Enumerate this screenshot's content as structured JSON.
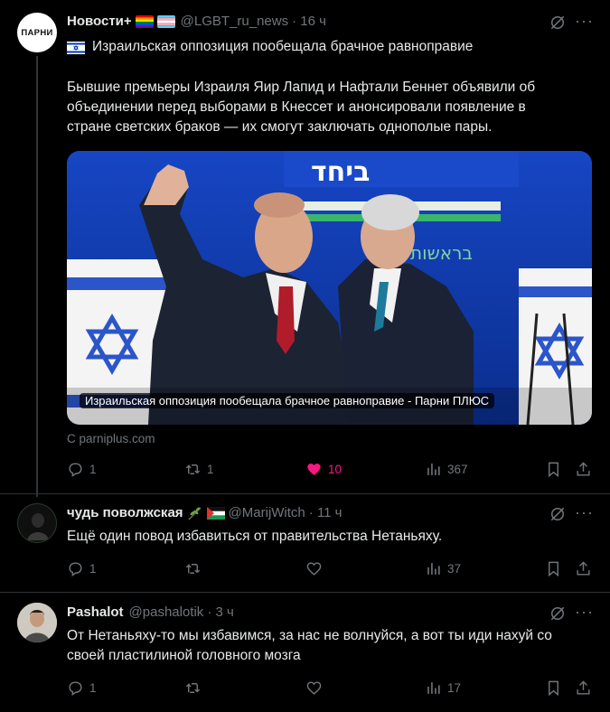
{
  "colors": {
    "background": "#000000",
    "text": "#e7e9ea",
    "muted": "#71767b",
    "like": "#f91880",
    "divider": "#2f3336"
  },
  "tweets": [
    {
      "author": "Новости+",
      "badges": [
        "rainbow-flag-icon",
        "trans-flag-icon"
      ],
      "handle": "@LGBT_ru_news",
      "time": "· 16 ч",
      "avatar_text": "ПАРНИ",
      "title": "Израильская оппозиция пообещала брачное равноправие",
      "title_icon": "israel-flag-icon",
      "body": "Бывшие премьеры Израиля Яир Лапид и Нафтали Беннет объявили об объединении перед выборами в Кнессет и анонсировали появление в стране светских браков — их смогут заключать однополые пары.",
      "card": {
        "caption": "Израильская оппозиция пообещала брачное равноправие - Парни ПЛЮС",
        "source": "С parniplus.com"
      },
      "actions": {
        "replies": "1",
        "retweets": "1",
        "likes": "10",
        "views": "367",
        "liked": true
      }
    },
    {
      "author": "чудь поволжская",
      "badges": [
        "olive-branch-icon",
        "palestine-flag-icon"
      ],
      "handle": "@MarijWitch",
      "time": "· 11 ч",
      "text": "Ещё один повод избавиться от правительства Нетаньяху.",
      "actions": {
        "replies": "1",
        "retweets": "",
        "likes": "",
        "views": "37",
        "liked": false
      }
    },
    {
      "author": "Pashalot",
      "handle": "@pashalotik",
      "time": "· 3 ч",
      "text": "От Нетаньяху-то мы избавимся, за нас не волнуйся, а вот ты иди нахуй со своей пластилиной головного мозга",
      "actions": {
        "replies": "1",
        "retweets": "",
        "likes": "",
        "views": "17",
        "liked": false
      }
    }
  ]
}
